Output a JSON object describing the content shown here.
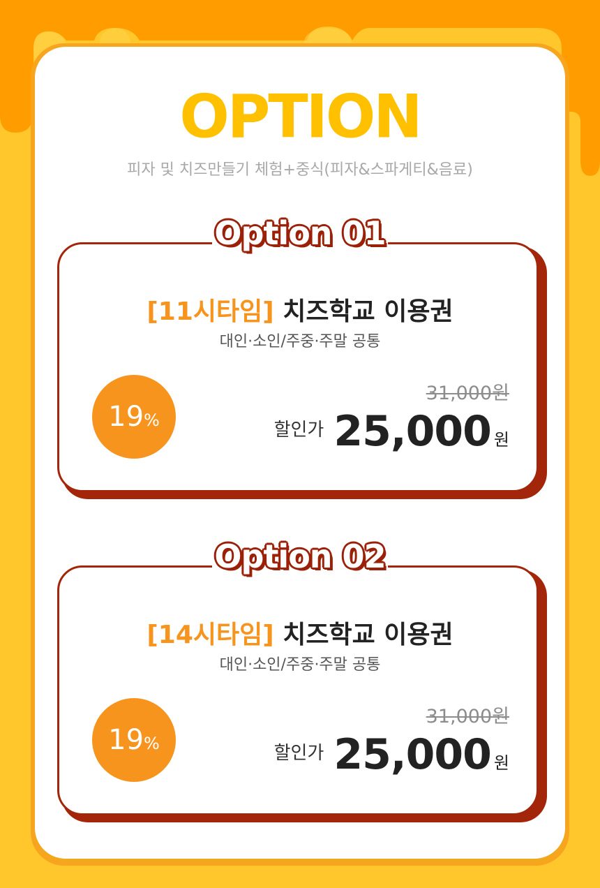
{
  "header": {
    "title": "OPTION",
    "subtitle": "피자 및 치즈만들기 체험+중식(피자&스파게티&음료)"
  },
  "colors": {
    "background": "#ffc72c",
    "drip": "#ff9c00",
    "accent": "#f7941d",
    "title": "#ffc000",
    "border": "#a3260a"
  },
  "options": [
    {
      "label": "Option 01",
      "title_highlight": "[11시타임]",
      "title_main": "치즈학교 이용권",
      "subtitle": "대인·소인/주중·주말 공통",
      "discount_value": "19",
      "discount_unit": "%",
      "original_price": "31,000원",
      "final_label": "할인가",
      "final_price": "25,000",
      "final_unit": "원"
    },
    {
      "label": "Option 02",
      "title_highlight": "[14시타임]",
      "title_main": "치즈학교 이용권",
      "subtitle": "대인·소인/주중·주말 공통",
      "discount_value": "19",
      "discount_unit": "%",
      "original_price": "31,000원",
      "final_label": "할인가",
      "final_price": "25,000",
      "final_unit": "원"
    }
  ]
}
